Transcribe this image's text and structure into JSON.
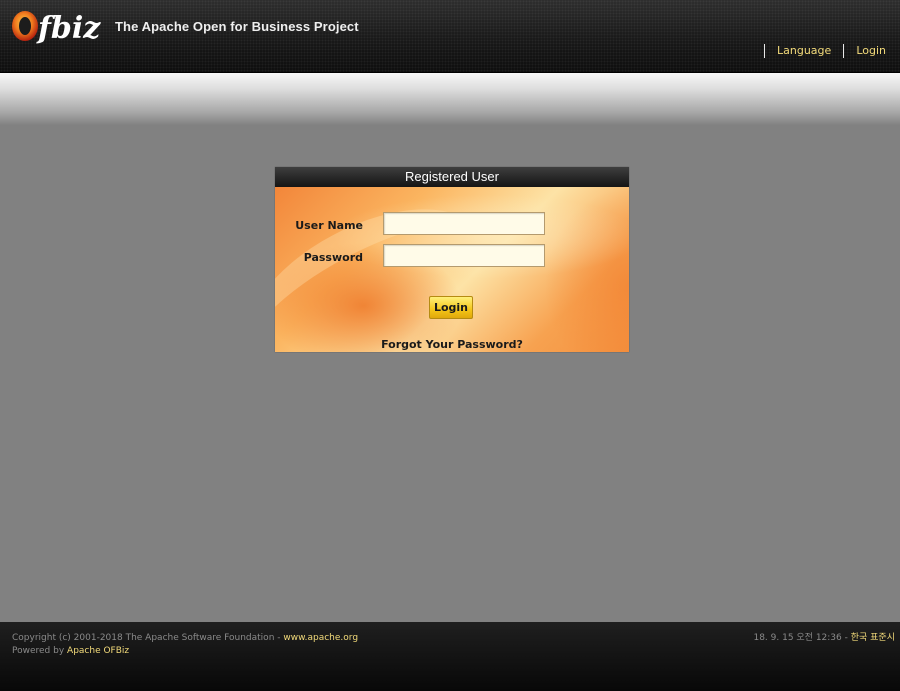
{
  "header": {
    "logo_text": "Ofbiz",
    "tagline": "The Apache Open for Business Project",
    "nav": [
      {
        "label": "Language"
      },
      {
        "label": "Login"
      }
    ]
  },
  "login_box": {
    "title": "Registered User",
    "username_label": "User Name",
    "password_label": "Password",
    "username_value": "",
    "password_value": "",
    "submit_label": "Login",
    "forgot_link": "Forgot Your Password?"
  },
  "footer": {
    "copyright": "Copyright (c) 2001-2018 The Apache Software Foundation - ",
    "apache_link": "www.apache.org",
    "powered_by": "Powered by ",
    "ofbiz_link": "Apache OFBiz",
    "datetime": "18. 9. 15 오전 12:36 - ",
    "timezone_link": "한국 표준시"
  },
  "colors": {
    "accent_link": "#f2da7a",
    "page_background": "#818181",
    "login_button": "#f4c61a"
  }
}
